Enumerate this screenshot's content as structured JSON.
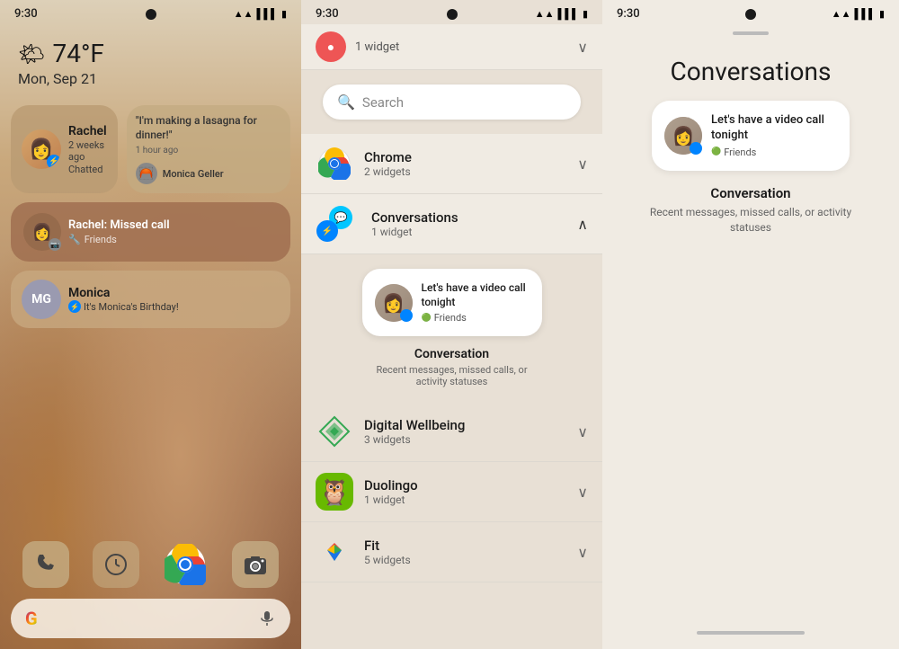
{
  "panels": {
    "home": {
      "status_time": "9:30",
      "weather_emoji": "🌤",
      "weather_temp": "74°F",
      "weather_date": "Mon, Sep 21",
      "widgets": [
        {
          "id": "rachel-chat",
          "name": "Rachel",
          "sub": "2 weeks ago",
          "action": "Chatted",
          "type": "chat"
        },
        {
          "id": "lasagna",
          "quote": "\"I'm making a lasagna for dinner!\"",
          "time": "1 hour ago",
          "name": "Monica Geller",
          "type": "status"
        },
        {
          "id": "missed-call",
          "text": "Rachel: Missed call",
          "sub": "Friends",
          "type": "missed-call"
        },
        {
          "id": "monica-birthday",
          "name": "Monica",
          "sub": "It's Monica's Birthday!",
          "type": "chat"
        }
      ],
      "dock_apps": [
        "phone",
        "clock",
        "chrome",
        "camera"
      ],
      "search_placeholder": "Google"
    },
    "widget_picker": {
      "status_time": "9:30",
      "search_placeholder": "Search",
      "apps": [
        {
          "name": "Chrome",
          "widget_count": "2 widgets",
          "expanded": false,
          "icon": "chrome"
        },
        {
          "name": "Conversations",
          "widget_count": "1 widget",
          "expanded": true,
          "icon": "conversations"
        },
        {
          "name": "Digital Wellbeing",
          "widget_count": "3 widgets",
          "expanded": false,
          "icon": "dw"
        },
        {
          "name": "Duolingo",
          "widget_count": "1 widget",
          "expanded": false,
          "icon": "duolingo"
        },
        {
          "name": "Fit",
          "widget_count": "5 widgets",
          "expanded": false,
          "icon": "fit"
        }
      ],
      "widget_preview": {
        "message": "Let's have a video call tonight",
        "from": "Friends",
        "label": "Conversation",
        "description": "Recent messages, missed calls, or activity statuses"
      }
    },
    "conversations": {
      "status_time": "9:30",
      "title": "Conversations",
      "preview": {
        "message": "Let's have a video call tonight",
        "from": "Friends",
        "label": "Conversation",
        "description": "Recent messages, missed calls, or activity statuses"
      }
    }
  }
}
